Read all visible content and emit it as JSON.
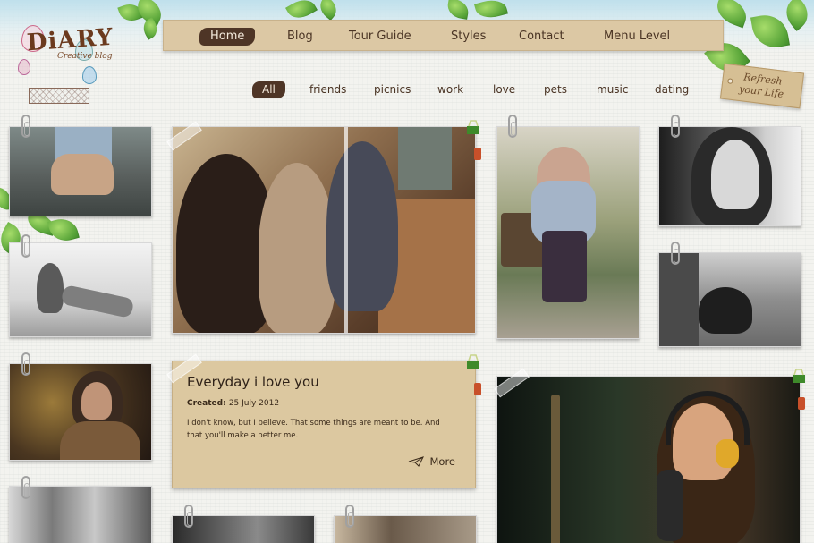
{
  "brand": {
    "title": "DiARY",
    "tagline": "Creative blog"
  },
  "main_nav": [
    {
      "label": "Home",
      "active": true
    },
    {
      "label": "Blog",
      "active": false
    },
    {
      "label": "Tour Guide",
      "active": false
    },
    {
      "label": "Styles",
      "active": false
    },
    {
      "label": "Contact",
      "active": false
    },
    {
      "label": "Menu Level",
      "active": false
    }
  ],
  "filters": [
    {
      "label": "All",
      "active": true
    },
    {
      "label": "friends",
      "active": false
    },
    {
      "label": "picnics",
      "active": false
    },
    {
      "label": "work",
      "active": false
    },
    {
      "label": "love",
      "active": false
    },
    {
      "label": "pets",
      "active": false
    },
    {
      "label": "music",
      "active": false
    },
    {
      "label": "dating",
      "active": false
    }
  ],
  "refresh_tag": {
    "line1": "Refresh",
    "line2": "your Life"
  },
  "post": {
    "title": "Everyday i love you",
    "date_label": "Created:",
    "date_value": "25 July 2012",
    "excerpt": "I don't know, but I believe. That some things are meant to be. And that you'll make a better me.",
    "more_label": "More"
  },
  "icons": {
    "more": "paper-plane-icon",
    "clip": "paperclip-icon",
    "binder": "binder-clip-icon"
  },
  "colors": {
    "nav_bg": "#dcc8a4",
    "active_pill": "#4e3526",
    "post_bg": "#dcc8a0",
    "leaf_green": "#5aa63a"
  }
}
